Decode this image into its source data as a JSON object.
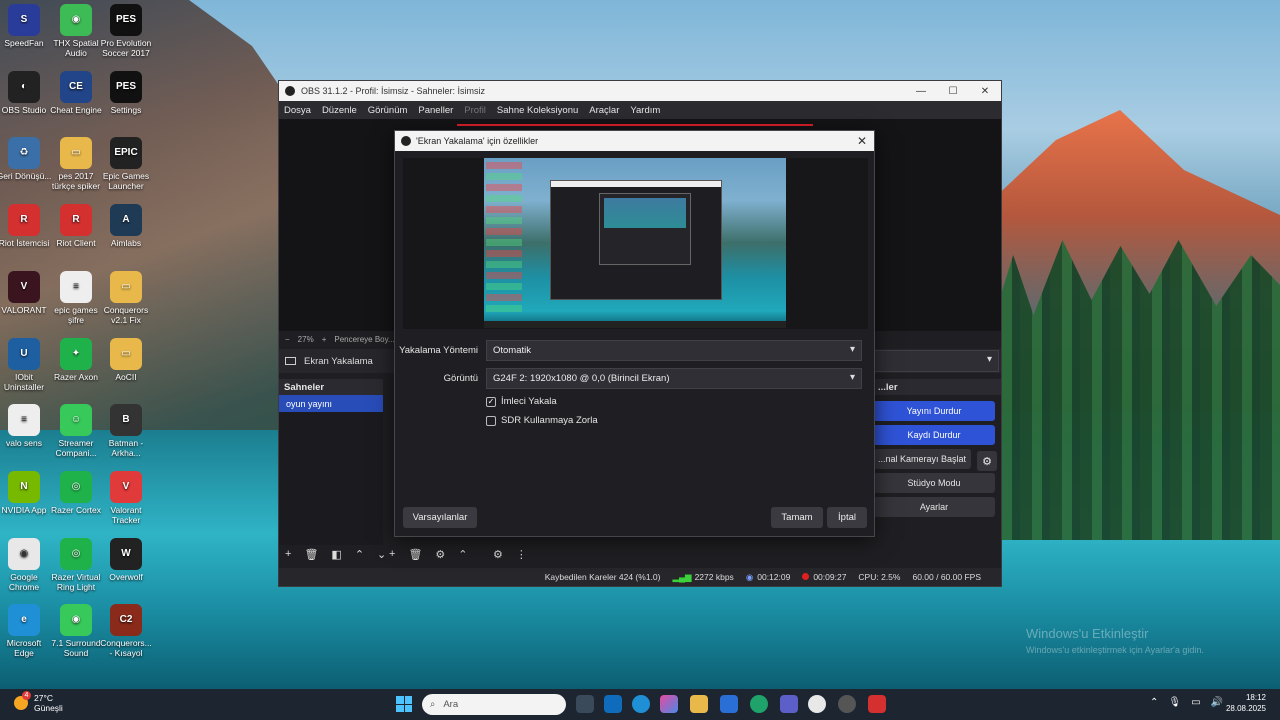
{
  "desktop": {
    "icons": [
      {
        "label": "SpeedFan",
        "color": "#2a3c9a",
        "glyph": "S"
      },
      {
        "label": "THX Spatial Audio",
        "color": "#3dbb55",
        "glyph": "◉"
      },
      {
        "label": "Pro Evolution Soccer 2017",
        "color": "#111",
        "glyph": "PES"
      },
      {
        "label": "OBS Studio",
        "color": "#222",
        "glyph": "◐"
      },
      {
        "label": "Cheat Engine",
        "color": "#224488",
        "glyph": "CE"
      },
      {
        "label": "Settings",
        "color": "#111",
        "glyph": "PES"
      },
      {
        "label": "Geri Dönüşü...",
        "color": "#3a6fa8",
        "glyph": "♻"
      },
      {
        "label": "pes 2017 türkçe spiker",
        "color": "#e8b84a",
        "glyph": "▭"
      },
      {
        "label": "Epic Games Launcher",
        "color": "#222",
        "glyph": "EPIC"
      },
      {
        "label": "Riot İstemcisi",
        "color": "#d43030",
        "glyph": "R"
      },
      {
        "label": "Riot Client",
        "color": "#d43030",
        "glyph": "R"
      },
      {
        "label": "Aimlabs",
        "color": "#1e3a55",
        "glyph": "A"
      },
      {
        "label": "VALORANT",
        "color": "#3a1520",
        "glyph": "V"
      },
      {
        "label": "epic games şifre",
        "color": "#eee",
        "glyph": "≡"
      },
      {
        "label": "Conquerors v2.1 Fix",
        "color": "#e8b84a",
        "glyph": "▭"
      },
      {
        "label": "IObit Uninstaller",
        "color": "#1d5fa0",
        "glyph": "U"
      },
      {
        "label": "Razer Axon",
        "color": "#1fb24a",
        "glyph": "✦"
      },
      {
        "label": "AoCII",
        "color": "#e8b84a",
        "glyph": "▭"
      },
      {
        "label": "valo sens",
        "color": "#eee",
        "glyph": "≡"
      },
      {
        "label": "Streamer Compani...",
        "color": "#37c95a",
        "glyph": "☺"
      },
      {
        "label": "Batman - Arkha...",
        "color": "#333",
        "glyph": "B"
      },
      {
        "label": "NVIDIA App",
        "color": "#76b900",
        "glyph": "N"
      },
      {
        "label": "Razer Cortex",
        "color": "#1fb24a",
        "glyph": "◎"
      },
      {
        "label": "Valorant Tracker",
        "color": "#e03a3a",
        "glyph": "V"
      },
      {
        "label": "Google Chrome",
        "color": "#e8e8e8",
        "glyph": "◉"
      },
      {
        "label": "Razer Virtual Ring Light",
        "color": "#1fb24a",
        "glyph": "◎"
      },
      {
        "label": "Overwolf",
        "color": "#222",
        "glyph": "W"
      },
      {
        "label": "Microsoft Edge",
        "color": "#1f8fd6",
        "glyph": "e"
      },
      {
        "label": "7.1 Surround Sound",
        "color": "#37c95a",
        "glyph": "◉"
      },
      {
        "label": "Conquerors... - Kısayol",
        "color": "#8a2a1a",
        "glyph": "C2"
      }
    ],
    "watermark_title": "Windows'u Etkinleştir",
    "watermark_sub": "Windows'u etkinleştirmek için Ayarlar'a gidin."
  },
  "obs": {
    "title": "OBS 31.1.2 - Profil: İsimsiz - Sahneler: İsimsiz",
    "menu": [
      "Dosya",
      "Düzenle",
      "Görünüm",
      "Paneller",
      "Profil",
      "Sahne Koleksiyonu",
      "Araçlar",
      "Yardım"
    ],
    "zoom_minus": "−",
    "zoom_level": "27%",
    "zoom_plus": "+",
    "zoom_fit": "Pencereye Boy...",
    "source_name": "Ekran Yakalama",
    "scenes_header": "Sahneler",
    "scene_item": "oyun yayını",
    "controls_header": "...ler",
    "controls": [
      {
        "label": "Yayını Durdur",
        "style": "blue"
      },
      {
        "label": "Kaydı Durdur",
        "style": "blue"
      },
      {
        "label": "...nal Kamerayı Başlat",
        "style": "gray"
      },
      {
        "label": "Stüdyo Modu",
        "style": "gray"
      },
      {
        "label": "Ayarlar",
        "style": "gray"
      }
    ],
    "status": {
      "dropped": "Kaybedilen Kareler 424 (%1.0)",
      "bitrate": "2272 kbps",
      "stream_time": "00:12:09",
      "rec_time": "00:09:27",
      "cpu": "CPU: 2.5%",
      "fps": "60.00 / 60.00 FPS"
    }
  },
  "dialog": {
    "title": "'Ekran Yakalama' için özellikler",
    "method_label": "Yakalama Yöntemi",
    "method_value": "Otomatik",
    "display_label": "Görüntü",
    "display_value": "G24F 2: 1920x1080 @ 0,0 (Birincil Ekran)",
    "cursor_label": "İmleci Yakala",
    "cursor_checked": true,
    "sdr_label": "SDR Kullanmaya Zorla",
    "sdr_checked": false,
    "defaults_button": "Varsayılanlar",
    "ok_button": "Tamam",
    "cancel_button": "İptal"
  },
  "taskbar": {
    "temp": "27°C",
    "weather": "Güneşli",
    "badge": "4",
    "search_placeholder": "Ara",
    "time": "18:12",
    "date": "28.08.2025"
  }
}
